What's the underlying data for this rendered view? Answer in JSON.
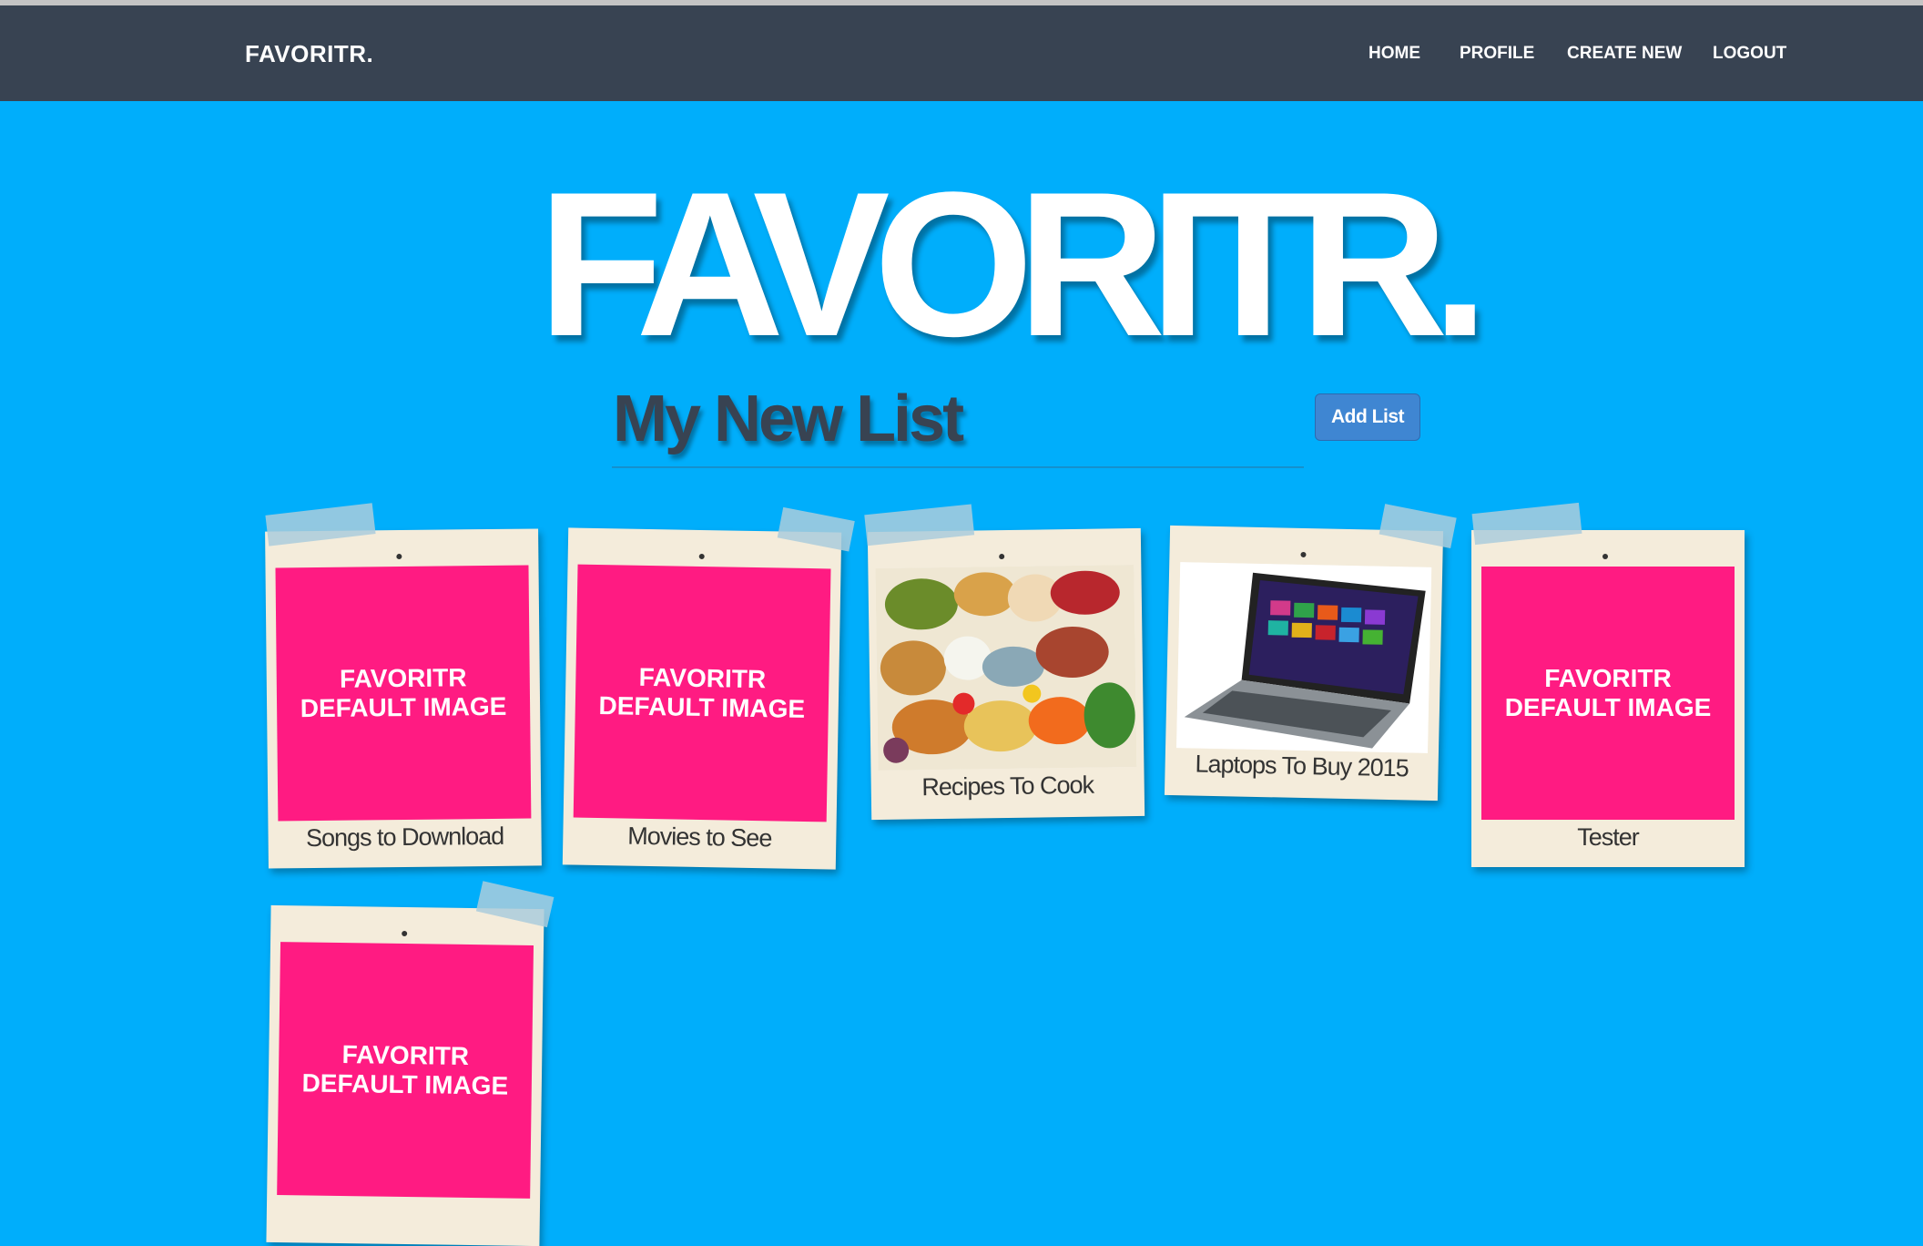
{
  "navbar": {
    "brand": "FAVORITR.",
    "links": [
      "HOME",
      "PROFILE",
      "CREATE NEW",
      "LOGOUT"
    ]
  },
  "hero": {
    "title": "FAVORITR."
  },
  "list": {
    "title": "My New List",
    "add_button": "Add List"
  },
  "cards": [
    {
      "caption": "Songs to Download",
      "image": "default",
      "image_text": [
        "FAVORITR",
        "DEFAULT IMAGE"
      ]
    },
    {
      "caption": "Movies to See",
      "image": "default",
      "image_text": [
        "FAVORITR",
        "DEFAULT IMAGE"
      ]
    },
    {
      "caption": "Recipes To Cook",
      "image": "food-photo"
    },
    {
      "caption": "Laptops To Buy 2015",
      "image": "laptop-photo"
    },
    {
      "caption": "Tester",
      "image": "default",
      "image_text": [
        "FAVORITR",
        "DEFAULT IMAGE"
      ]
    },
    {
      "caption": "",
      "image": "default",
      "image_text": [
        "FAVORITR",
        "DEFAULT IMAGE"
      ]
    }
  ],
  "colors": {
    "background": "#00aefb",
    "navbar": "#384352",
    "default_image": "#ff1b82",
    "card_paper": "#f4ecdb",
    "button": "#3f86d2"
  }
}
